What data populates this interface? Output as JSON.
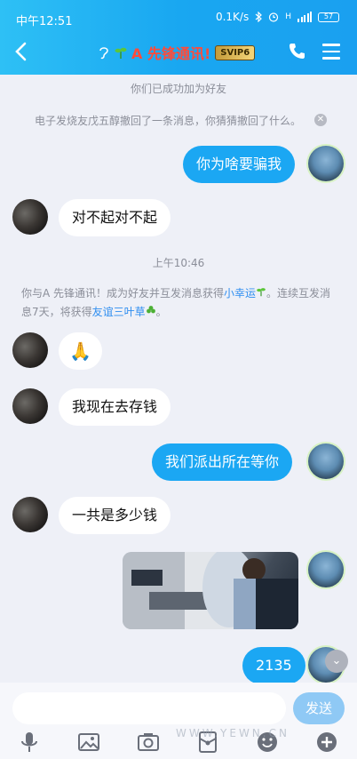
{
  "status_bar": {
    "time": "中午12:51",
    "net_speed": "0.1K/s",
    "signal": "H",
    "battery": "57"
  },
  "header": {
    "back_icon": "chevron-left-icon",
    "title": "A 先锋通讯!",
    "badge": "SVIP6",
    "phone_icon": "phone-icon",
    "menu_icon": "menu-icon",
    "accent_color": "#1aa7f1",
    "title_color": "#ff4b3a"
  },
  "messages": {
    "added_friend": "你们已成功加为好友",
    "recall_notice": "电子发烧友戊五醇撤回了一条消息，你猜猜撤回了什么。",
    "m1": "你为啥要骗我",
    "m2": "对不起对不起",
    "time_divider": "上午10:46",
    "sys_p1": "你与A 先锋通讯！成为好友并互发消息获得",
    "sys_link1": "小幸运",
    "sys_p2": "。连续互发消息7天，将获得",
    "sys_link2": "友谊三叶草",
    "sys_p3": "。",
    "m3": "🙏",
    "m4": "我现在去存钱",
    "m5": "我们派出所在等你",
    "m6": "一共是多少钱",
    "m7": "2135"
  },
  "input_bar": {
    "placeholder": "",
    "send_label": "发送",
    "tools": [
      "microphone-icon",
      "image-icon",
      "camera-icon",
      "red-packet-icon",
      "emoji-icon",
      "plus-icon"
    ]
  },
  "watermark": "WWW.YEWN.CN"
}
